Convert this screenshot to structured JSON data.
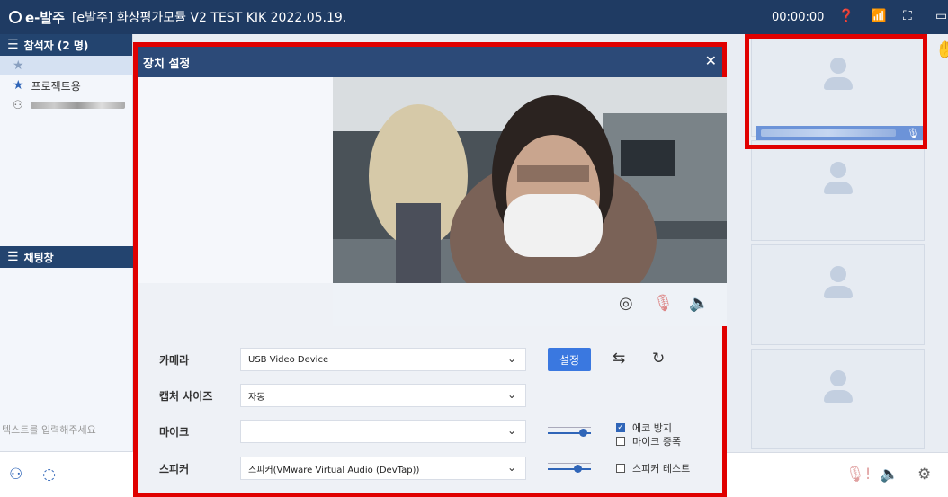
{
  "titlebar": {
    "brand": "e-발주",
    "title": "[e발주] 화상평가모듈 V2 TEST KIK 2022.05.19.",
    "timer": "00:00:00"
  },
  "participants": {
    "header": "참석자 (2 명)",
    "items": [
      {
        "label": ""
      },
      {
        "label": "프로젝트용"
      }
    ]
  },
  "chat": {
    "header": "채팅창",
    "placeholder": "텍스트를 입력해주세요"
  },
  "dialog": {
    "title": "장치 설정",
    "camera_label": "카메라",
    "camera_value": "USB Video Device",
    "set_button": "설정",
    "capture_label": "캡처 사이즈",
    "capture_value": "자동",
    "mic_label": "마이크",
    "mic_value": "",
    "speaker_label": "스피커",
    "speaker_value": "스피커(VMware Virtual Audio (DevTap))",
    "echo_label": "에코 방지",
    "echo_checked": true,
    "mic_boost_label": "마이크 증폭",
    "mic_boost_checked": false,
    "speaker_test_label": "스피커 테스트",
    "speaker_test_checked": false,
    "mic_level": 0.9,
    "speaker_level": 0.75
  },
  "colors": {
    "titlebar": "#1f3b63",
    "accent": "#2f65b8",
    "highlight": "#e00000"
  }
}
